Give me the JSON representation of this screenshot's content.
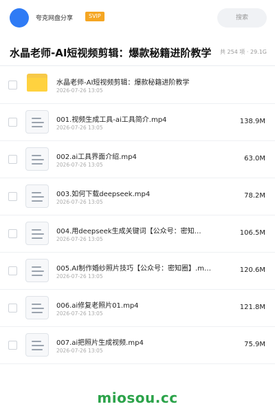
{
  "header": {
    "brand": "夸克网盘分享",
    "badge": "SVIP",
    "search_placeholder": "搜索"
  },
  "folder": {
    "title": "水晶老师-AI短视频剪辑：爆款秘籍进阶教学",
    "meta": "共 254 项 · 29.1G"
  },
  "files": [
    {
      "type": "folder",
      "name": "水晶老师-AI短视频剪辑：爆款秘籍进阶教学",
      "date": "2026-07-26 13:05",
      "size": ""
    },
    {
      "type": "file",
      "name": "001.视频生成工具-ai工具简介.mp4",
      "date": "2026-07-26 13:05",
      "size": "138.9M"
    },
    {
      "type": "file",
      "name": "002.ai工具界面介绍.mp4",
      "date": "2026-07-26 13:05",
      "size": "63.0M"
    },
    {
      "type": "file",
      "name": "003.如何下载deepseek.mp4",
      "date": "2026-07-26 13:05",
      "size": "78.2M"
    },
    {
      "type": "file",
      "name": "004.用deepseek生成关键词【公众号：密知…",
      "date": "2026-07-26 13:05",
      "size": "106.5M"
    },
    {
      "type": "file",
      "name": "005.AI制作婚纱照片技巧【公众号：密知圈】.m…",
      "date": "2026-07-26 13:05",
      "size": "120.6M"
    },
    {
      "type": "file",
      "name": "006.ai修复老照片01.mp4",
      "date": "2026-07-26 13:05",
      "size": "121.8M"
    },
    {
      "type": "file",
      "name": "007.ai把照片生成视频.mp4",
      "date": "2026-07-26 13:05",
      "size": "75.9M"
    }
  ],
  "watermark": "miosou.cc"
}
